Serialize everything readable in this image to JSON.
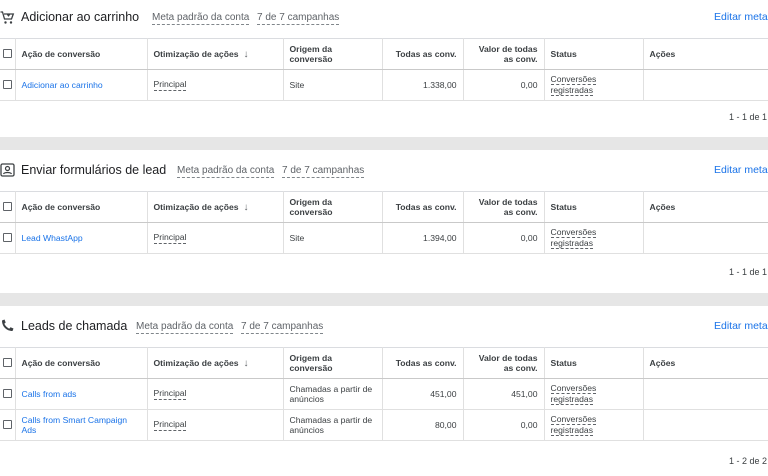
{
  "columns": {
    "acao": "Ação de conversão",
    "otimizacao": "Otimização de ações",
    "origem": "Origem da conversão",
    "todas": "Todas as conv.",
    "valor": "Valor de todas as conv.",
    "status": "Status",
    "acoes": "Ações"
  },
  "header_common": {
    "meta": "Meta padrão da conta",
    "campanhas": "7 de 7 campanhas",
    "editar": "Editar meta"
  },
  "sections": [
    {
      "title": "Adicionar ao carrinho",
      "icon": "cart-icon",
      "pager": "1 - 1 de 1",
      "rows": [
        {
          "acao": "Adicionar ao carrinho",
          "otimizacao": "Principal",
          "origem": "Site",
          "todas": "1.338,00",
          "valor": "0,00",
          "status_l1": "Conversões",
          "status_l2": "registradas"
        }
      ]
    },
    {
      "title": "Enviar formulários de lead",
      "icon": "contact-form-icon",
      "pager": "1 - 1 de 1",
      "rows": [
        {
          "acao": "Lead WhastApp",
          "otimizacao": "Principal",
          "origem": "Site",
          "todas": "1.394,00",
          "valor": "0,00",
          "status_l1": "Conversões",
          "status_l2": "registradas"
        }
      ]
    },
    {
      "title": "Leads de chamada",
      "icon": "phone-icon",
      "pager": "1 - 2 de 2",
      "rows": [
        {
          "acao": "Calls from ads",
          "otimizacao": "Principal",
          "origem_l1": "Chamadas a partir de",
          "origem_l2": "anúncios",
          "todas": "451,00",
          "valor": "451,00",
          "status_l1": "Conversões",
          "status_l2": "registradas"
        },
        {
          "acao_l1": "Calls from Smart Campaign",
          "acao_l2": "Ads",
          "otimizacao": "Principal",
          "origem_l1": "Chamadas a partir de",
          "origem_l2": "anúncios",
          "todas": "80,00",
          "valor": "0,00",
          "status_l1": "Conversões",
          "status_l2": "registradas"
        }
      ]
    }
  ]
}
